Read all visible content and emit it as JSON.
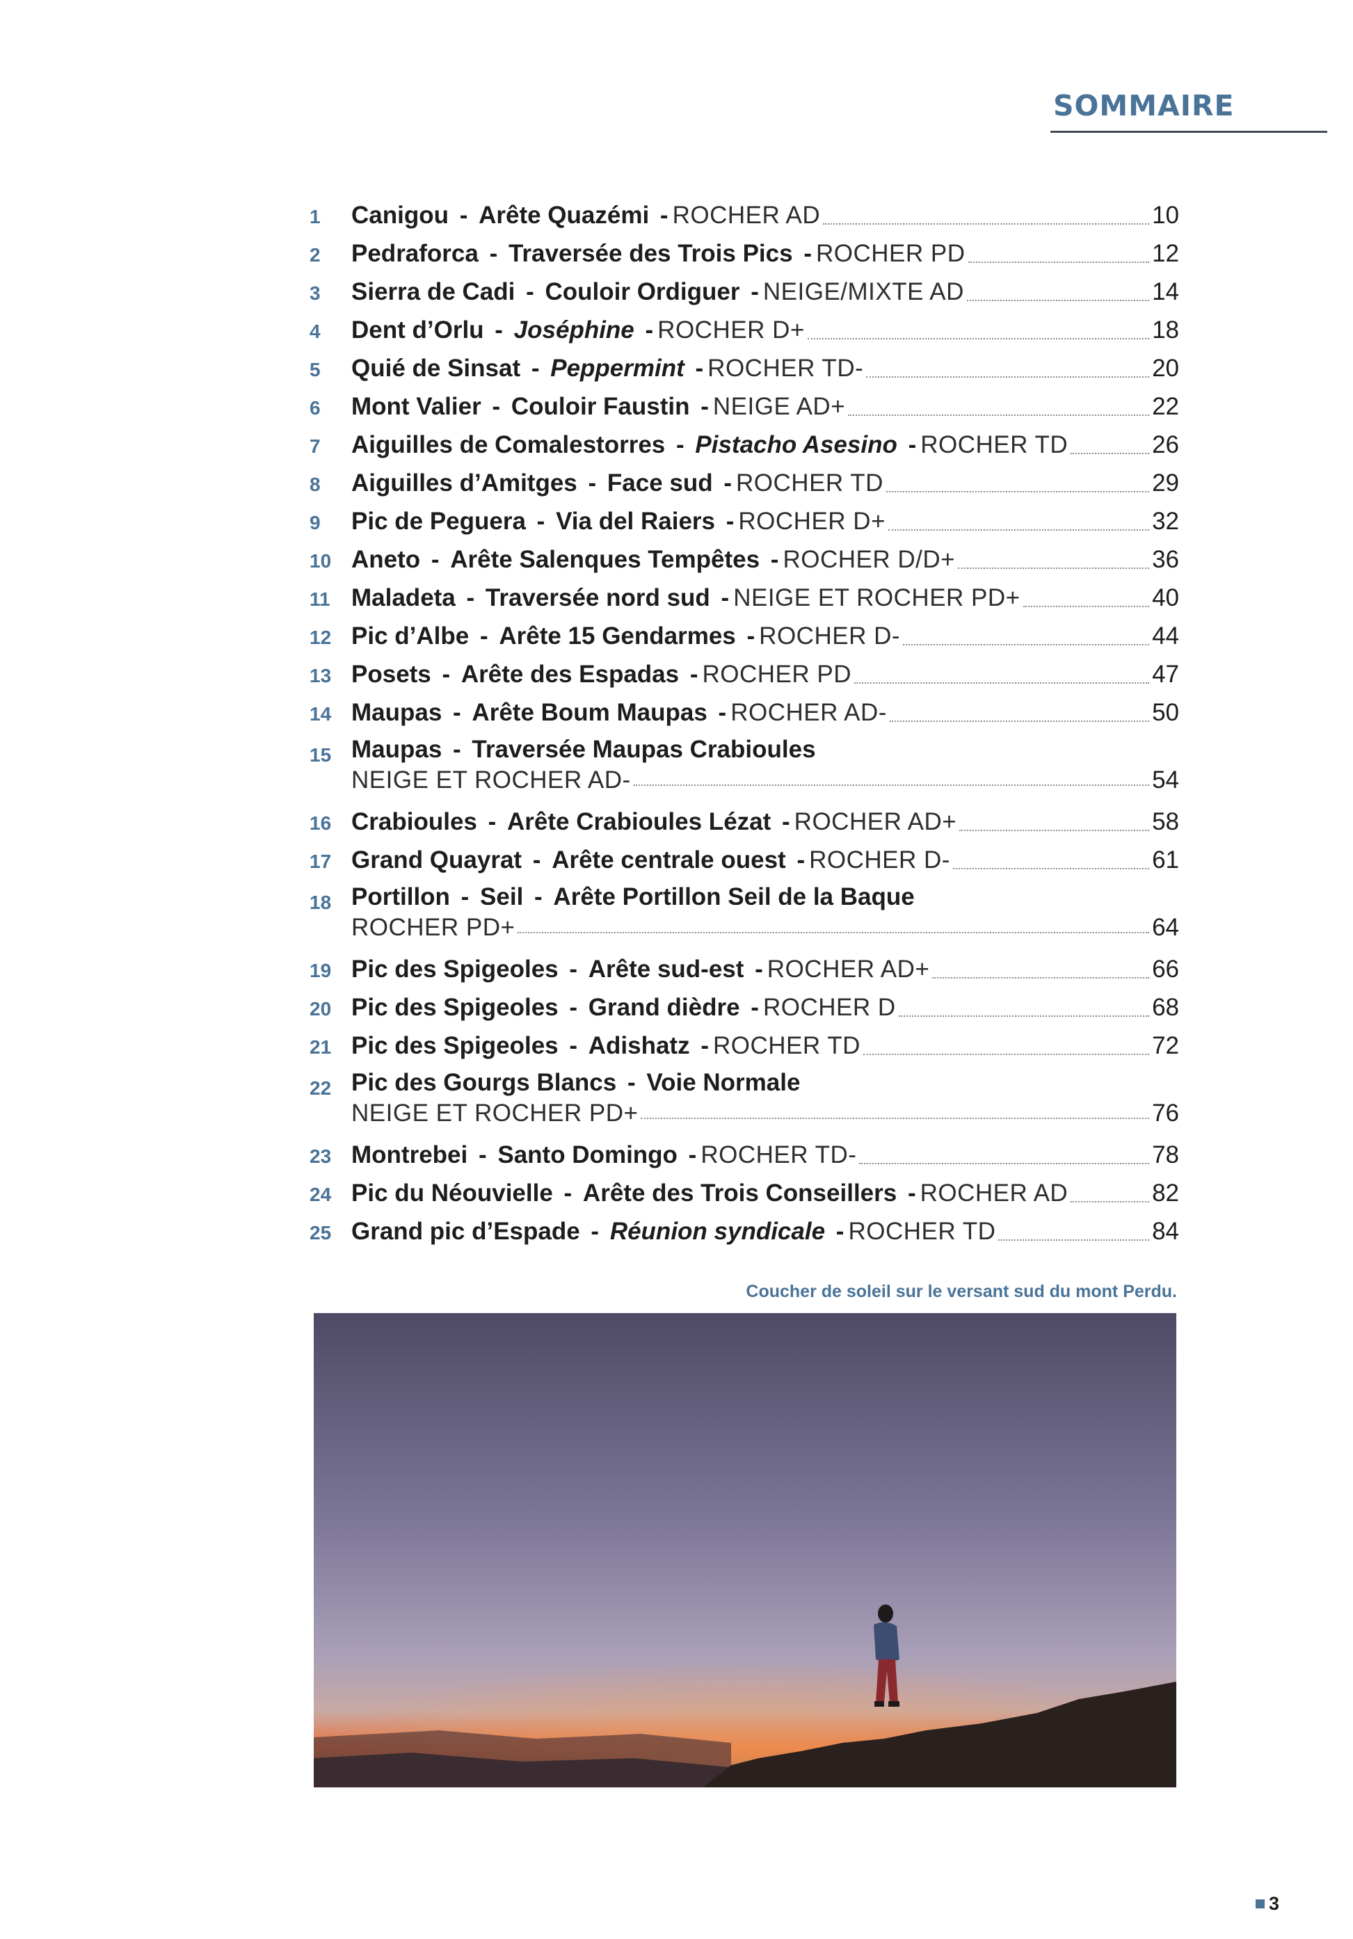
{
  "header": {
    "title": "SOMMAIRE"
  },
  "toc": [
    {
      "num": "1",
      "parts": [
        {
          "text": "Canigou"
        },
        {
          "text": "Arête Quazémi"
        }
      ],
      "grade": "ROCHER AD",
      "page": "10"
    },
    {
      "num": "2",
      "parts": [
        {
          "text": "Pedraforca"
        },
        {
          "text": "Traversée des Trois Pics"
        }
      ],
      "grade": "ROCHER PD",
      "page": "12"
    },
    {
      "num": "3",
      "parts": [
        {
          "text": "Sierra de Cadi"
        },
        {
          "text": "Couloir Ordiguer"
        }
      ],
      "grade": "NEIGE/MIXTE AD",
      "page": "14"
    },
    {
      "num": "4",
      "parts": [
        {
          "text": "Dent d’Orlu"
        },
        {
          "text": "Joséphine",
          "italic": true
        }
      ],
      "grade": "ROCHER D+",
      "page": "18"
    },
    {
      "num": "5",
      "parts": [
        {
          "text": "Quié de Sinsat"
        },
        {
          "text": "Peppermint",
          "italic": true
        }
      ],
      "grade": "ROCHER TD-",
      "page": "20"
    },
    {
      "num": "6",
      "parts": [
        {
          "text": "Mont Valier"
        },
        {
          "text": "Couloir Faustin"
        }
      ],
      "grade": "NEIGE AD+",
      "page": "22"
    },
    {
      "num": "7",
      "parts": [
        {
          "text": "Aiguilles de Comalestorres"
        },
        {
          "text": "Pistacho Asesino",
          "italic": true
        }
      ],
      "grade": "ROCHER TD",
      "page": "26"
    },
    {
      "num": "8",
      "parts": [
        {
          "text": "Aiguilles d’Amitges"
        },
        {
          "text": "Face sud"
        }
      ],
      "grade": "ROCHER TD",
      "page": "29"
    },
    {
      "num": "9",
      "parts": [
        {
          "text": "Pic de Peguera"
        },
        {
          "text": "Via del Raiers"
        }
      ],
      "grade": "ROCHER D+",
      "page": "32"
    },
    {
      "num": "10",
      "parts": [
        {
          "text": "Aneto"
        },
        {
          "text": "Arête Salenques Tempêtes"
        }
      ],
      "grade": "ROCHER D/D+",
      "page": "36"
    },
    {
      "num": "11",
      "parts": [
        {
          "text": "Maladeta"
        },
        {
          "text": "Traversée nord sud"
        }
      ],
      "grade": "NEIGE ET ROCHER PD+",
      "page": "40"
    },
    {
      "num": "12",
      "parts": [
        {
          "text": "Pic d’Albe"
        },
        {
          "text": "Arête 15 Gendarmes"
        }
      ],
      "grade": "ROCHER D-",
      "page": "44"
    },
    {
      "num": "13",
      "parts": [
        {
          "text": "Posets"
        },
        {
          "text": "Arête des Espadas"
        }
      ],
      "grade": "ROCHER PD",
      "page": "47"
    },
    {
      "num": "14",
      "parts": [
        {
          "text": "Maupas"
        },
        {
          "text": "Arête Boum Maupas"
        }
      ],
      "grade": "ROCHER AD-",
      "page": "50"
    },
    {
      "num": "15",
      "parts": [
        {
          "text": "Maupas"
        },
        {
          "text": "Traversée Maupas Crabioules"
        }
      ],
      "grade": "NEIGE ET ROCHER AD-",
      "page": "54",
      "wrap": true
    },
    {
      "num": "16",
      "parts": [
        {
          "text": "Crabioules"
        },
        {
          "text": "Arête Crabioules Lézat"
        }
      ],
      "grade": "ROCHER AD+",
      "page": "58"
    },
    {
      "num": "17",
      "parts": [
        {
          "text": "Grand Quayrat"
        },
        {
          "text": "Arête centrale ouest"
        }
      ],
      "grade": "ROCHER D-",
      "page": "61"
    },
    {
      "num": "18",
      "parts": [
        {
          "text": "Portillon"
        },
        {
          "text": "Seil"
        },
        {
          "text": "Arête Portillon Seil de la Baque"
        }
      ],
      "grade": "ROCHER PD+",
      "page": "64",
      "wrap": true
    },
    {
      "num": "19",
      "parts": [
        {
          "text": "Pic des Spigeoles"
        },
        {
          "text": "Arête sud-est"
        }
      ],
      "grade": "ROCHER AD+",
      "page": "66"
    },
    {
      "num": "20",
      "parts": [
        {
          "text": "Pic des Spigeoles"
        },
        {
          "text": "Grand dièdre"
        }
      ],
      "grade": "ROCHER D",
      "page": "68"
    },
    {
      "num": "21",
      "parts": [
        {
          "text": "Pic des Spigeoles"
        },
        {
          "text": "Adishatz"
        }
      ],
      "grade": "ROCHER TD",
      "page": "72"
    },
    {
      "num": "22",
      "parts": [
        {
          "text": "Pic des Gourgs Blancs"
        },
        {
          "text": "Voie Normale"
        }
      ],
      "grade": "NEIGE ET ROCHER PD+",
      "page": "76",
      "wrap": true
    },
    {
      "num": "23",
      "parts": [
        {
          "text": "Montrebei"
        },
        {
          "text": "Santo Domingo"
        }
      ],
      "grade": "ROCHER TD-",
      "page": "78"
    },
    {
      "num": "24",
      "parts": [
        {
          "text": "Pic du Néouvielle"
        },
        {
          "text": "Arête des Trois Conseillers"
        }
      ],
      "grade": "ROCHER AD",
      "page": "82"
    },
    {
      "num": "25",
      "parts": [
        {
          "text": "Grand pic d’Espade"
        },
        {
          "text": "Réunion syndicale",
          "italic": true
        }
      ],
      "grade": "ROCHER TD",
      "page": "84"
    }
  ],
  "separator": "-",
  "caption": "Coucher de soleil sur le versant sud du mont Perdu.",
  "photo": {
    "sky_top": "#4d4a66",
    "sky_mid": "#8e84a8",
    "horizon": "#e8703a",
    "ground": "#2a201e"
  },
  "folio": "3",
  "colors": {
    "accent": "#4a7398",
    "text": "#1d1d1b"
  }
}
